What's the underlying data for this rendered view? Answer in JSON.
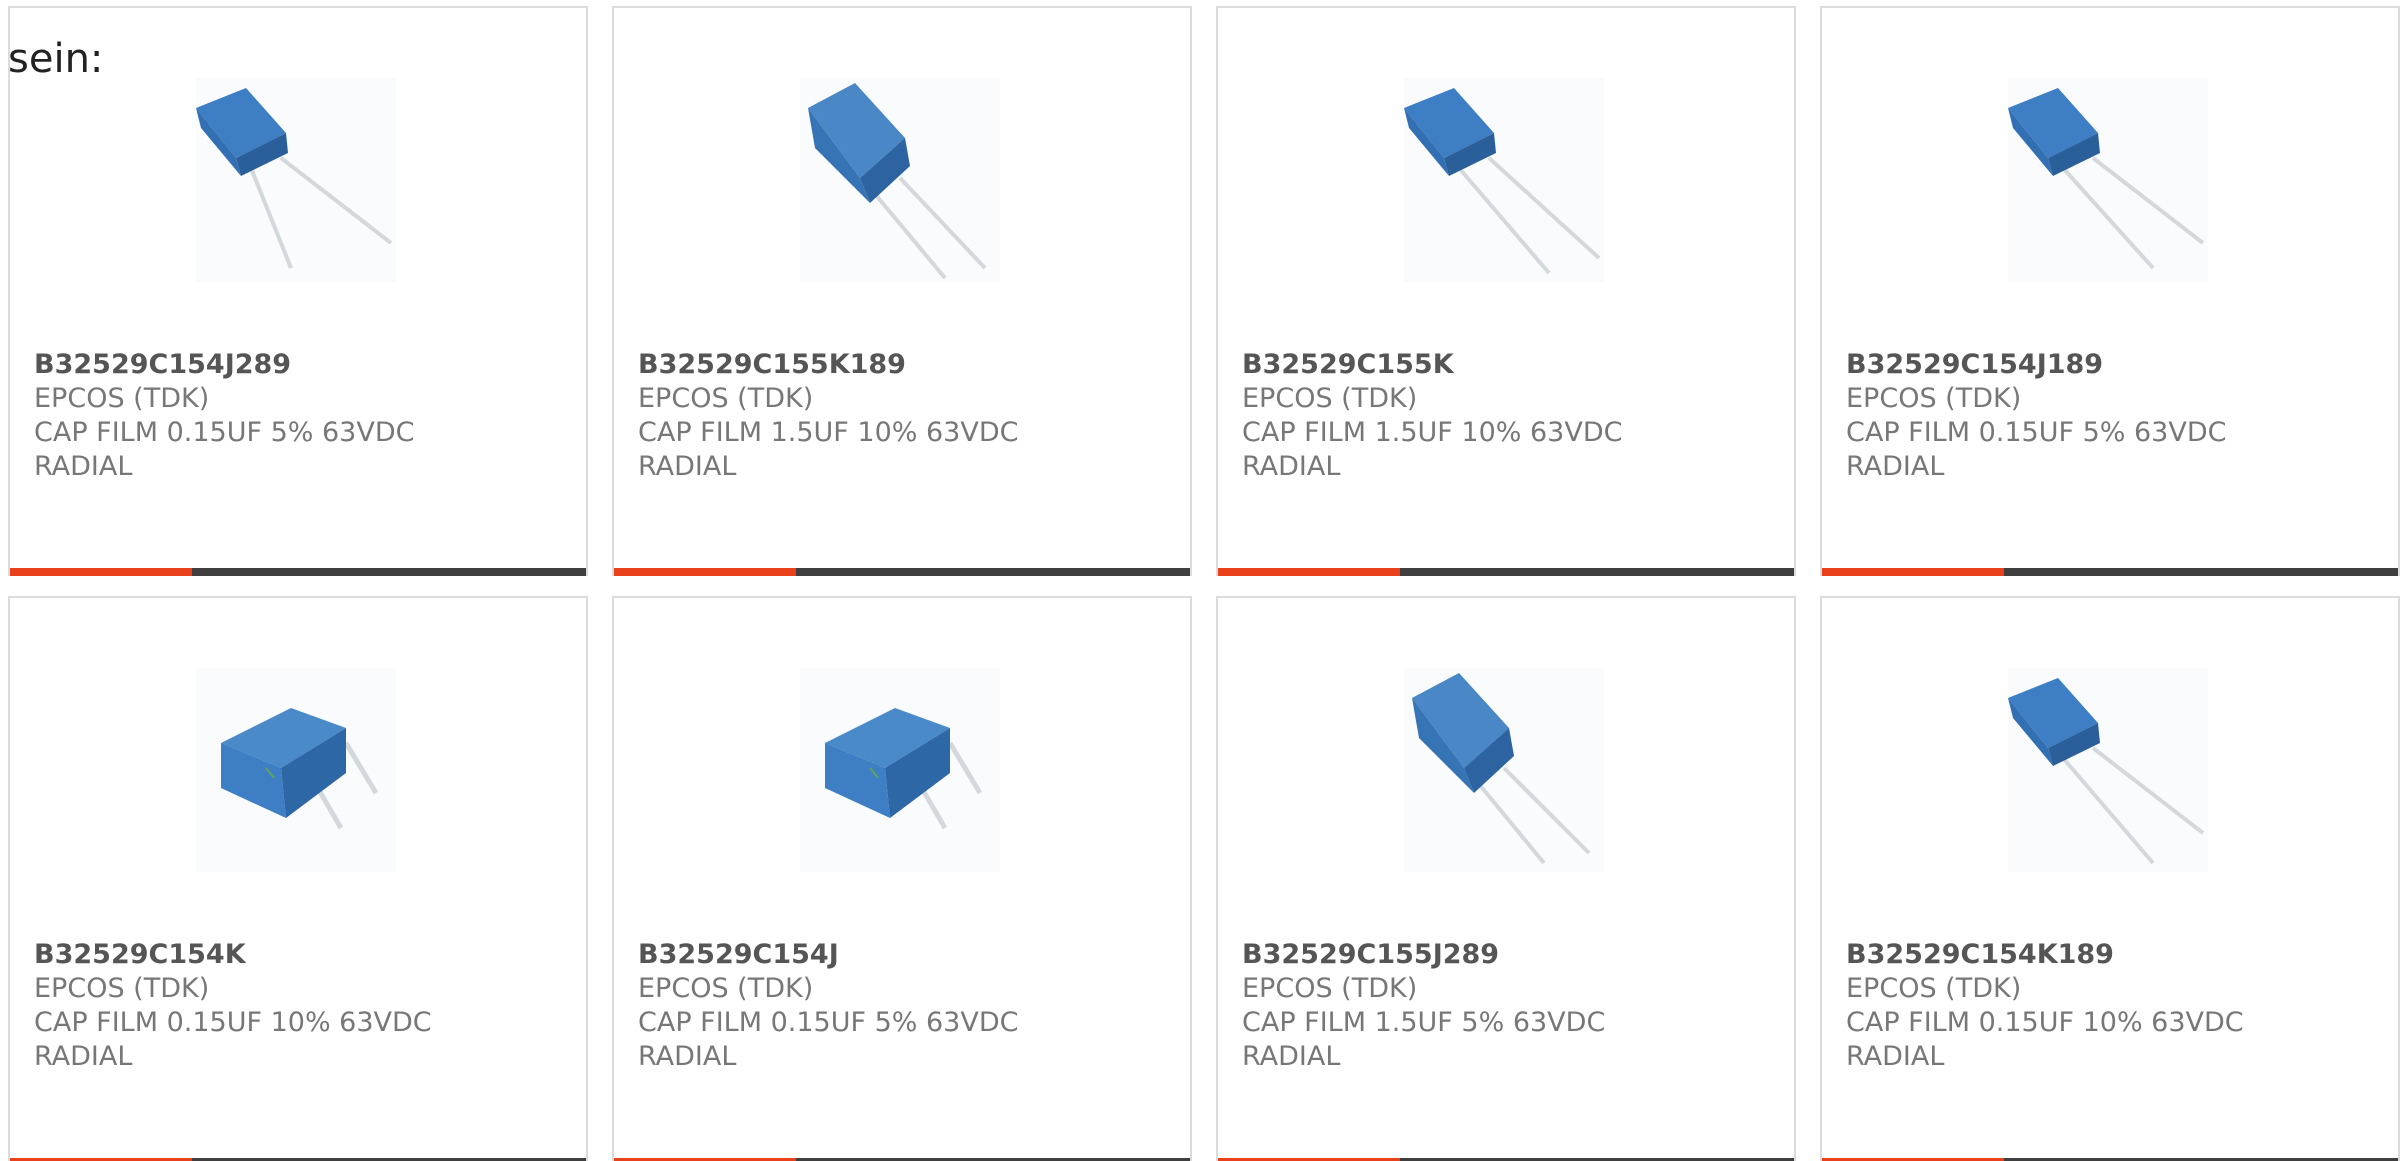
{
  "heading": "sein:",
  "colors": {
    "accent": "#e8411c",
    "bar": "#3f3f3f",
    "card_border": "#dcdcdc",
    "text": "#777777",
    "part_text": "#555555",
    "capacitor_blue": "#3d7ec4"
  },
  "products": [
    {
      "part": "B32529C154J289",
      "maker": "EPCOS (TDK)",
      "desc1": "CAP FILM 0.15UF 5% 63VDC",
      "desc2": "RADIAL",
      "image": "capacitor-tall-leads"
    },
    {
      "part": "B32529C155K189",
      "maker": "EPCOS (TDK)",
      "desc1": "CAP FILM 1.5UF 10% 63VDC",
      "desc2": "RADIAL",
      "image": "capacitor-large"
    },
    {
      "part": "B32529C155K",
      "maker": "EPCOS (TDK)",
      "desc1": "CAP FILM 1.5UF 10% 63VDC",
      "desc2": "RADIAL",
      "image": "capacitor-tall-leads"
    },
    {
      "part": "B32529C154J189",
      "maker": "EPCOS (TDK)",
      "desc1": "CAP FILM 0.15UF 5% 63VDC",
      "desc2": "RADIAL",
      "image": "capacitor-tall-leads"
    },
    {
      "part": "B32529C154K",
      "maker": "EPCOS (TDK)",
      "desc1": "CAP FILM 0.15UF 10% 63VDC",
      "desc2": "RADIAL",
      "image": "capacitor-short-leads"
    },
    {
      "part": "B32529C154J",
      "maker": "EPCOS (TDK)",
      "desc1": "CAP FILM 0.15UF 5% 63VDC",
      "desc2": "RADIAL",
      "image": "capacitor-short-leads"
    },
    {
      "part": "B32529C155J289",
      "maker": "EPCOS (TDK)",
      "desc1": "CAP FILM 1.5UF 5% 63VDC",
      "desc2": "RADIAL",
      "image": "capacitor-large"
    },
    {
      "part": "B32529C154K189",
      "maker": "EPCOS (TDK)",
      "desc1": "CAP FILM 0.15UF 10% 63VDC",
      "desc2": "RADIAL",
      "image": "capacitor-tall-leads"
    }
  ]
}
